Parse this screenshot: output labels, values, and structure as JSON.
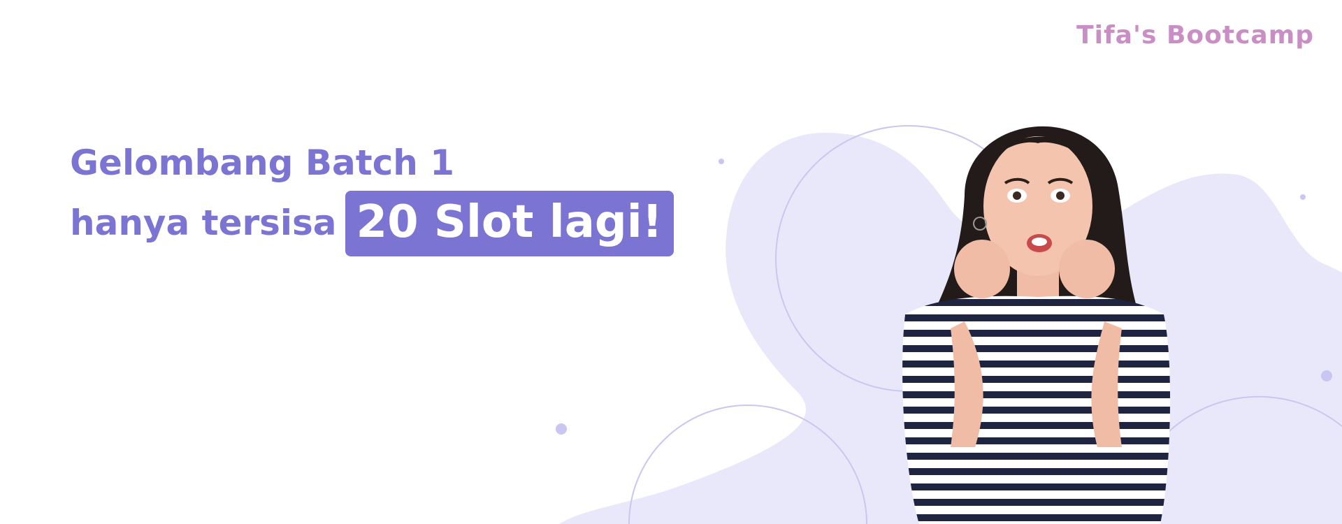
{
  "brand": {
    "logo_text": "Tifa's Bootcamp"
  },
  "headline": {
    "line1": "Gelombang Batch 1",
    "line2": "hanya tersisa",
    "badge": "20 Slot lagi!"
  },
  "colors": {
    "accent": "#7b74d3",
    "blob": "#e9e8fb",
    "logo": "#c98fc4",
    "ring": "#c9c6f1"
  },
  "image": {
    "subject": "surprised-woman-photo"
  }
}
